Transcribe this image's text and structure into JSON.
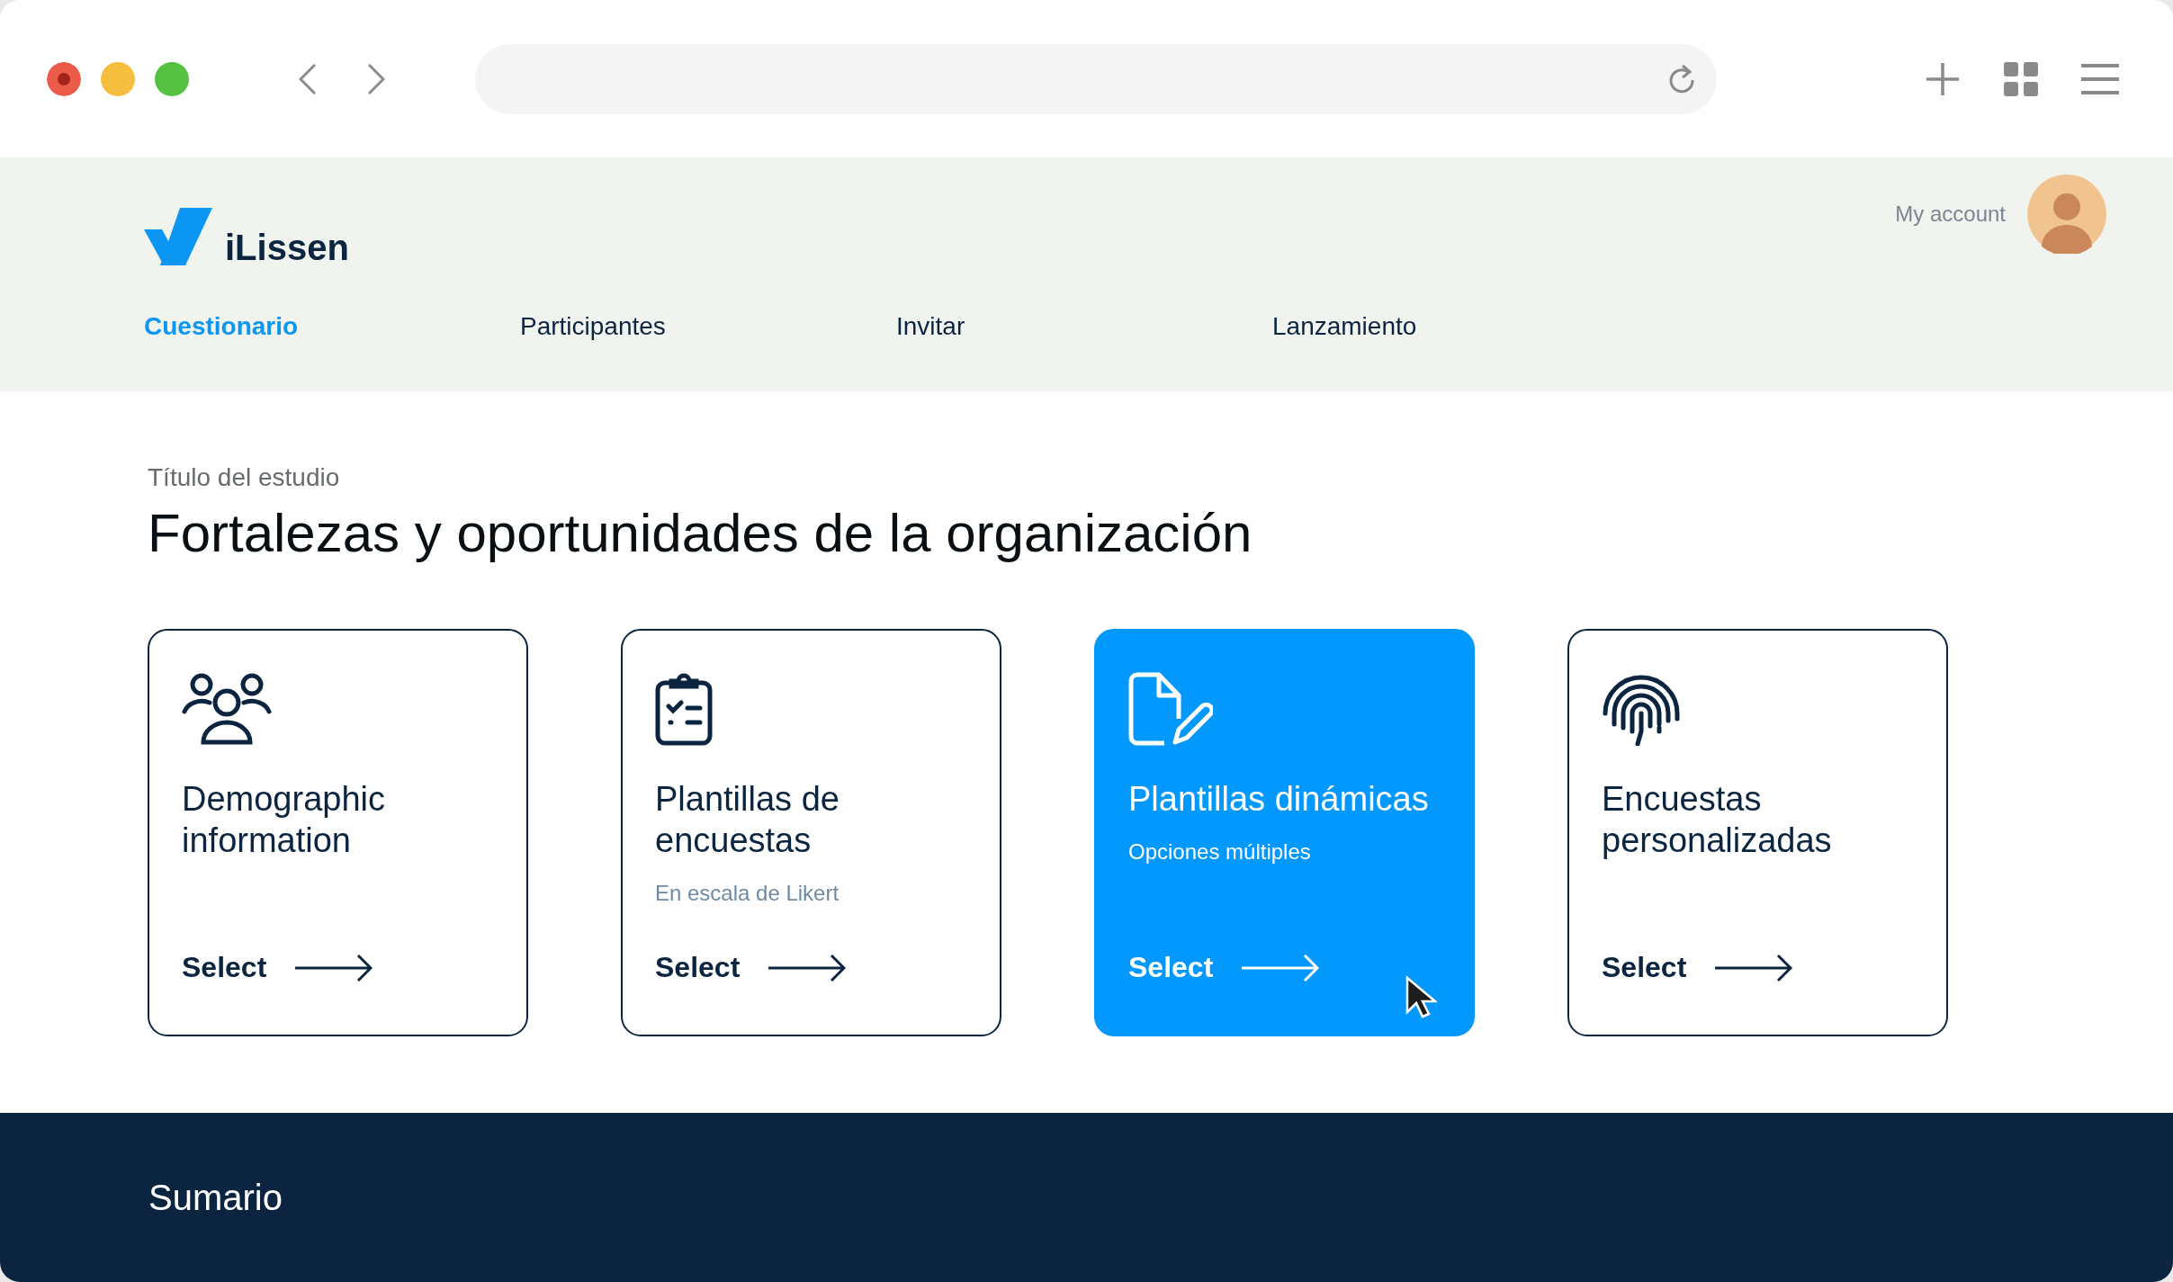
{
  "header": {
    "logo": "iLissen",
    "account": "My account",
    "tabs": [
      {
        "label": "Cuestionario",
        "selected": true
      },
      {
        "label": "Participantes",
        "selected": false
      },
      {
        "label": "Invitar",
        "selected": false
      },
      {
        "label": "Lanzamiento",
        "selected": false
      }
    ]
  },
  "study": {
    "label": "Título del estudio",
    "title": "Fortalezas y oportunidades de la organización"
  },
  "cards": [
    {
      "kind": "people",
      "title": "Demographic information",
      "action": "Select",
      "selected": false
    },
    {
      "kind": "clipboard",
      "title": "Plantillas de encuestas",
      "subtitle": "En escala de Likert",
      "action": "Select",
      "selected": false
    },
    {
      "kind": "document",
      "title": "Plantillas dinámicas",
      "subtitle": "Opciones múltiples",
      "action": "Select",
      "selected": true
    },
    {
      "kind": "fingerprint",
      "title": "Encuestas personalizadas",
      "action": "Select",
      "selected": false
    }
  ],
  "footer": {
    "title": "Sumario"
  }
}
